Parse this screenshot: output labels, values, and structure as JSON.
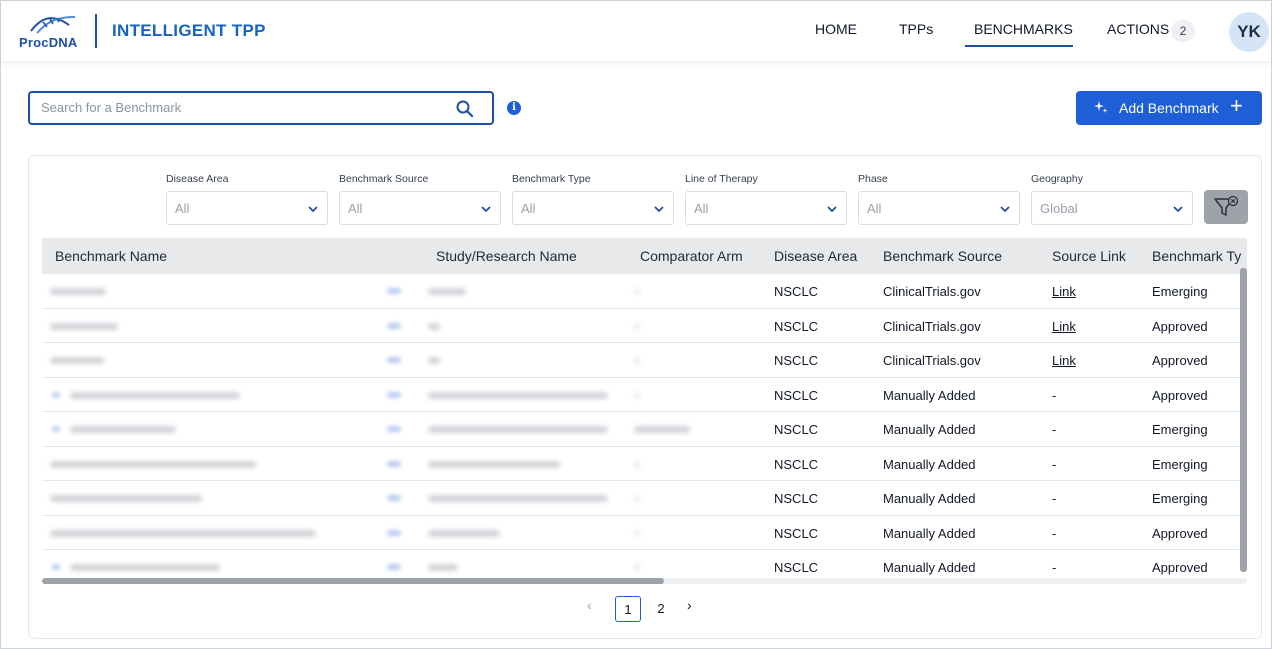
{
  "header": {
    "logo_text": "ProcDNA",
    "app_title": "INTELLIGENT TPP",
    "nav": [
      {
        "label": "HOME"
      },
      {
        "label": "TPPs"
      },
      {
        "label": "BENCHMARKS"
      },
      {
        "label": "ACTIONS"
      }
    ],
    "actions_count": "2",
    "avatar_initials": "YK"
  },
  "search": {
    "placeholder": "Search for a Benchmark",
    "value": ""
  },
  "add_button_label": "Add Benchmark",
  "filters": [
    {
      "label": "Disease Area",
      "value": "All"
    },
    {
      "label": "Benchmark Source",
      "value": "All"
    },
    {
      "label": "Benchmark Type",
      "value": "All"
    },
    {
      "label": "Line of Therapy",
      "value": "All"
    },
    {
      "label": "Phase",
      "value": "All"
    },
    {
      "label": "Geography",
      "value": "Global"
    }
  ],
  "table": {
    "columns": [
      "Benchmark Name",
      "Study/Research Name",
      "Comparator Arm",
      "Disease Area",
      "Benchmark Source",
      "Source Link",
      "Benchmark Ty"
    ],
    "rows": [
      {
        "disease_area": "NSCLC",
        "source": "ClinicalTrials.gov",
        "link": "Link",
        "type": "Emerging"
      },
      {
        "disease_area": "NSCLC",
        "source": "ClinicalTrials.gov",
        "link": "Link",
        "type": "Approved"
      },
      {
        "disease_area": "NSCLC",
        "source": "ClinicalTrials.gov",
        "link": "Link",
        "type": "Approved"
      },
      {
        "disease_area": "NSCLC",
        "source": "Manually Added",
        "link": "-",
        "type": "Approved"
      },
      {
        "disease_area": "NSCLC",
        "source": "Manually Added",
        "link": "-",
        "type": "Emerging"
      },
      {
        "disease_area": "NSCLC",
        "source": "Manually Added",
        "link": "-",
        "type": "Emerging"
      },
      {
        "disease_area": "NSCLC",
        "source": "Manually Added",
        "link": "-",
        "type": "Emerging"
      },
      {
        "disease_area": "NSCLC",
        "source": "Manually Added",
        "link": "-",
        "type": "Approved"
      },
      {
        "disease_area": "NSCLC",
        "source": "Manually Added",
        "link": "-",
        "type": "Approved"
      }
    ]
  },
  "pagination": {
    "pages": [
      "1",
      "2"
    ],
    "current": "1"
  },
  "colors": {
    "brand": "#1e4fa3",
    "accent": "#1e5fd8",
    "header_bg": "#e8e9eb"
  }
}
